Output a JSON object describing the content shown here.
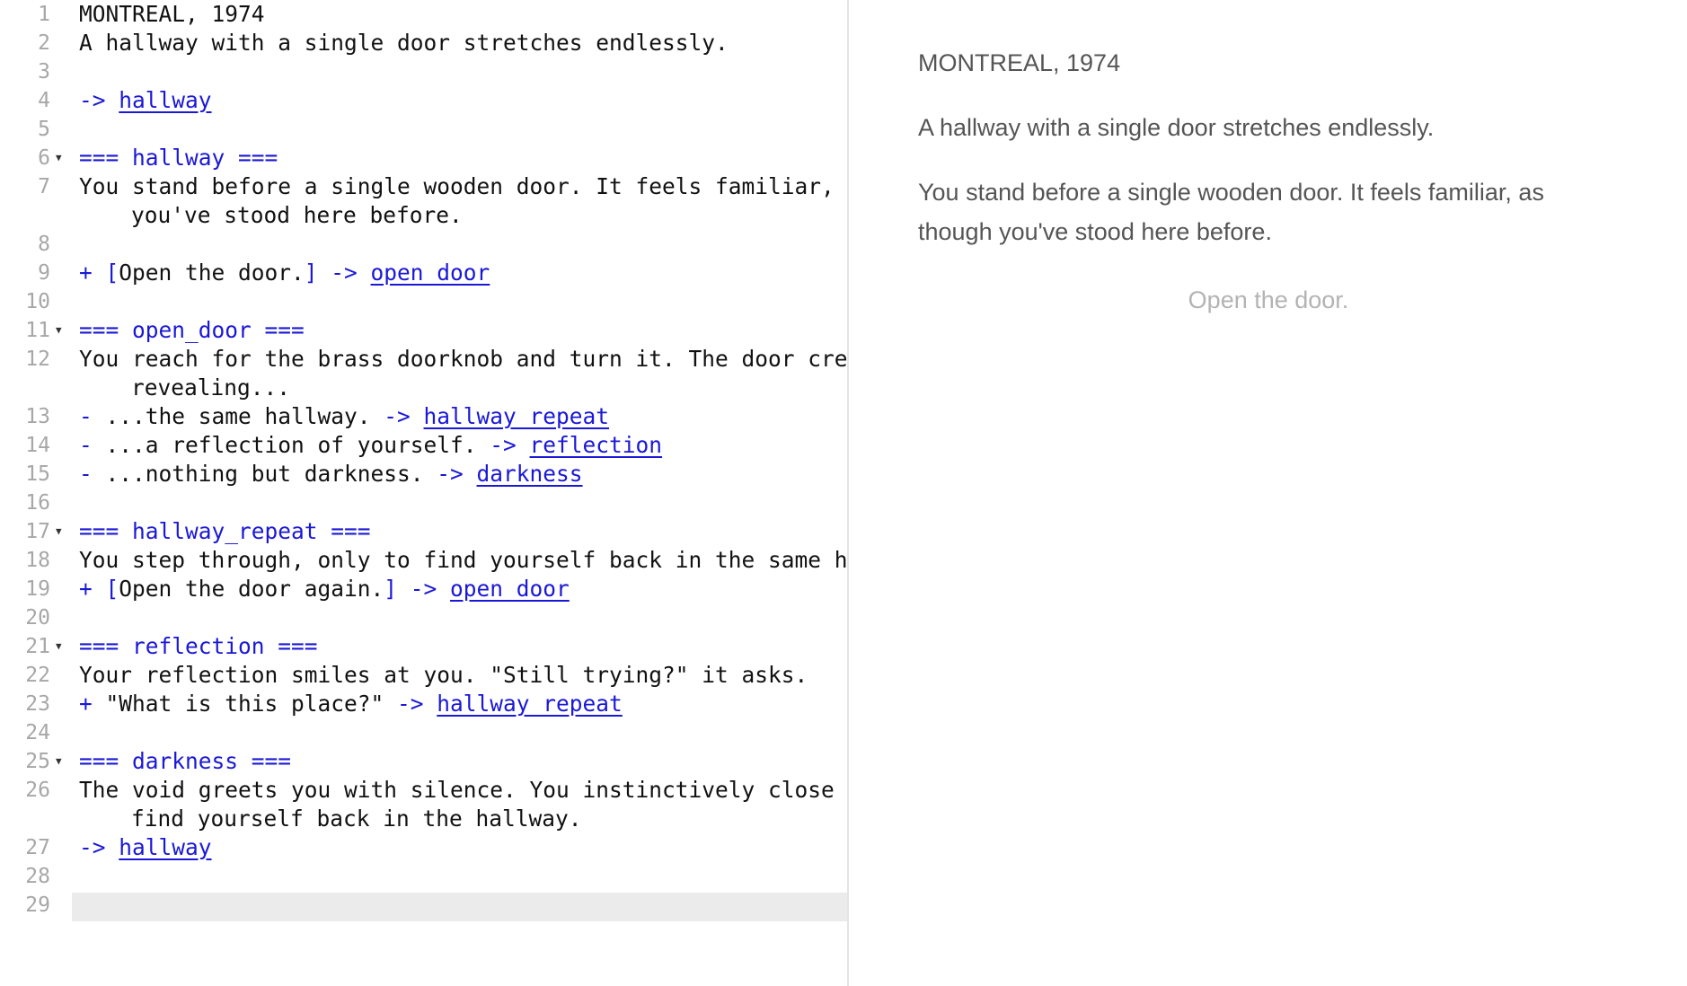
{
  "editor": {
    "lines": [
      {
        "num": "1",
        "segs": [
          {
            "t": "MONTREAL, 1974",
            "c": ""
          }
        ]
      },
      {
        "num": "2",
        "segs": [
          {
            "t": "A hallway with a single door stretches endlessly.",
            "c": ""
          }
        ]
      },
      {
        "num": "3",
        "segs": []
      },
      {
        "num": "4",
        "segs": [
          {
            "t": "-> ",
            "c": "kw"
          },
          {
            "t": "hallway",
            "c": "lk"
          }
        ]
      },
      {
        "num": "5",
        "segs": []
      },
      {
        "num": "6",
        "fold": true,
        "segs": [
          {
            "t": "=== hallway ===",
            "c": "kw"
          }
        ]
      },
      {
        "num": "7",
        "segs": [
          {
            "t": "You stand before a single wooden door. It feels familiar, a",
            "c": ""
          }
        ]
      },
      {
        "num": "",
        "cont": true,
        "segs": [
          {
            "t": "you've stood here before.",
            "c": ""
          }
        ]
      },
      {
        "num": "8",
        "segs": []
      },
      {
        "num": "9",
        "segs": [
          {
            "t": "+ [",
            "c": "kw"
          },
          {
            "t": "Open the door.",
            "c": ""
          },
          {
            "t": "] -> ",
            "c": "kw"
          },
          {
            "t": "open_door",
            "c": "lk"
          }
        ]
      },
      {
        "num": "10",
        "segs": []
      },
      {
        "num": "11",
        "fold": true,
        "segs": [
          {
            "t": "=== open_door ===",
            "c": "kw"
          }
        ]
      },
      {
        "num": "12",
        "segs": [
          {
            "t": "You reach for the brass doorknob and turn it. The door crea",
            "c": ""
          }
        ]
      },
      {
        "num": "",
        "cont": true,
        "segs": [
          {
            "t": "revealing...",
            "c": ""
          }
        ]
      },
      {
        "num": "13",
        "segs": [
          {
            "t": "- ",
            "c": "kw"
          },
          {
            "t": "...the same hallway. ",
            "c": ""
          },
          {
            "t": "-> ",
            "c": "kw"
          },
          {
            "t": "hallway_repeat",
            "c": "lk"
          }
        ]
      },
      {
        "num": "14",
        "segs": [
          {
            "t": "- ",
            "c": "kw"
          },
          {
            "t": "...a reflection of yourself. ",
            "c": ""
          },
          {
            "t": "-> ",
            "c": "kw"
          },
          {
            "t": "reflection",
            "c": "lk"
          }
        ]
      },
      {
        "num": "15",
        "segs": [
          {
            "t": "- ",
            "c": "kw"
          },
          {
            "t": "...nothing but darkness. ",
            "c": ""
          },
          {
            "t": "-> ",
            "c": "kw"
          },
          {
            "t": "darkness",
            "c": "lk"
          }
        ]
      },
      {
        "num": "16",
        "segs": []
      },
      {
        "num": "17",
        "fold": true,
        "segs": [
          {
            "t": "=== hallway_repeat ===",
            "c": "kw"
          }
        ]
      },
      {
        "num": "18",
        "segs": [
          {
            "t": "You step through, only to find yourself back in the same ha",
            "c": ""
          }
        ]
      },
      {
        "num": "19",
        "segs": [
          {
            "t": "+ [",
            "c": "kw"
          },
          {
            "t": "Open the door again.",
            "c": ""
          },
          {
            "t": "] -> ",
            "c": "kw"
          },
          {
            "t": "open_door",
            "c": "lk"
          }
        ]
      },
      {
        "num": "20",
        "segs": []
      },
      {
        "num": "21",
        "fold": true,
        "segs": [
          {
            "t": "=== reflection ===",
            "c": "kw"
          }
        ]
      },
      {
        "num": "22",
        "segs": [
          {
            "t": "Your reflection smiles at you. \"Still trying?\" it asks.",
            "c": ""
          }
        ]
      },
      {
        "num": "23",
        "segs": [
          {
            "t": "+ ",
            "c": "kw"
          },
          {
            "t": "\"What is this place?\" ",
            "c": ""
          },
          {
            "t": "-> ",
            "c": "kw"
          },
          {
            "t": "hallway_repeat",
            "c": "lk"
          }
        ]
      },
      {
        "num": "24",
        "segs": []
      },
      {
        "num": "25",
        "fold": true,
        "segs": [
          {
            "t": "=== darkness ===",
            "c": "kw"
          }
        ]
      },
      {
        "num": "26",
        "segs": [
          {
            "t": "The void greets you with silence. You instinctively close t",
            "c": ""
          }
        ]
      },
      {
        "num": "",
        "cont": true,
        "segs": [
          {
            "t": "find yourself back in the hallway.",
            "c": ""
          }
        ]
      },
      {
        "num": "27",
        "segs": [
          {
            "t": "-> ",
            "c": "kw"
          },
          {
            "t": "hallway",
            "c": "lk"
          }
        ]
      },
      {
        "num": "28",
        "segs": []
      },
      {
        "num": "29",
        "active": true,
        "segs": []
      }
    ]
  },
  "preview": {
    "title": "MONTREAL, 1974",
    "para1": "A hallway with a single door stretches endlessly.",
    "para2": "You stand before a single wooden door. It feels familiar, as though you've stood here before.",
    "choice": "Open the door."
  }
}
